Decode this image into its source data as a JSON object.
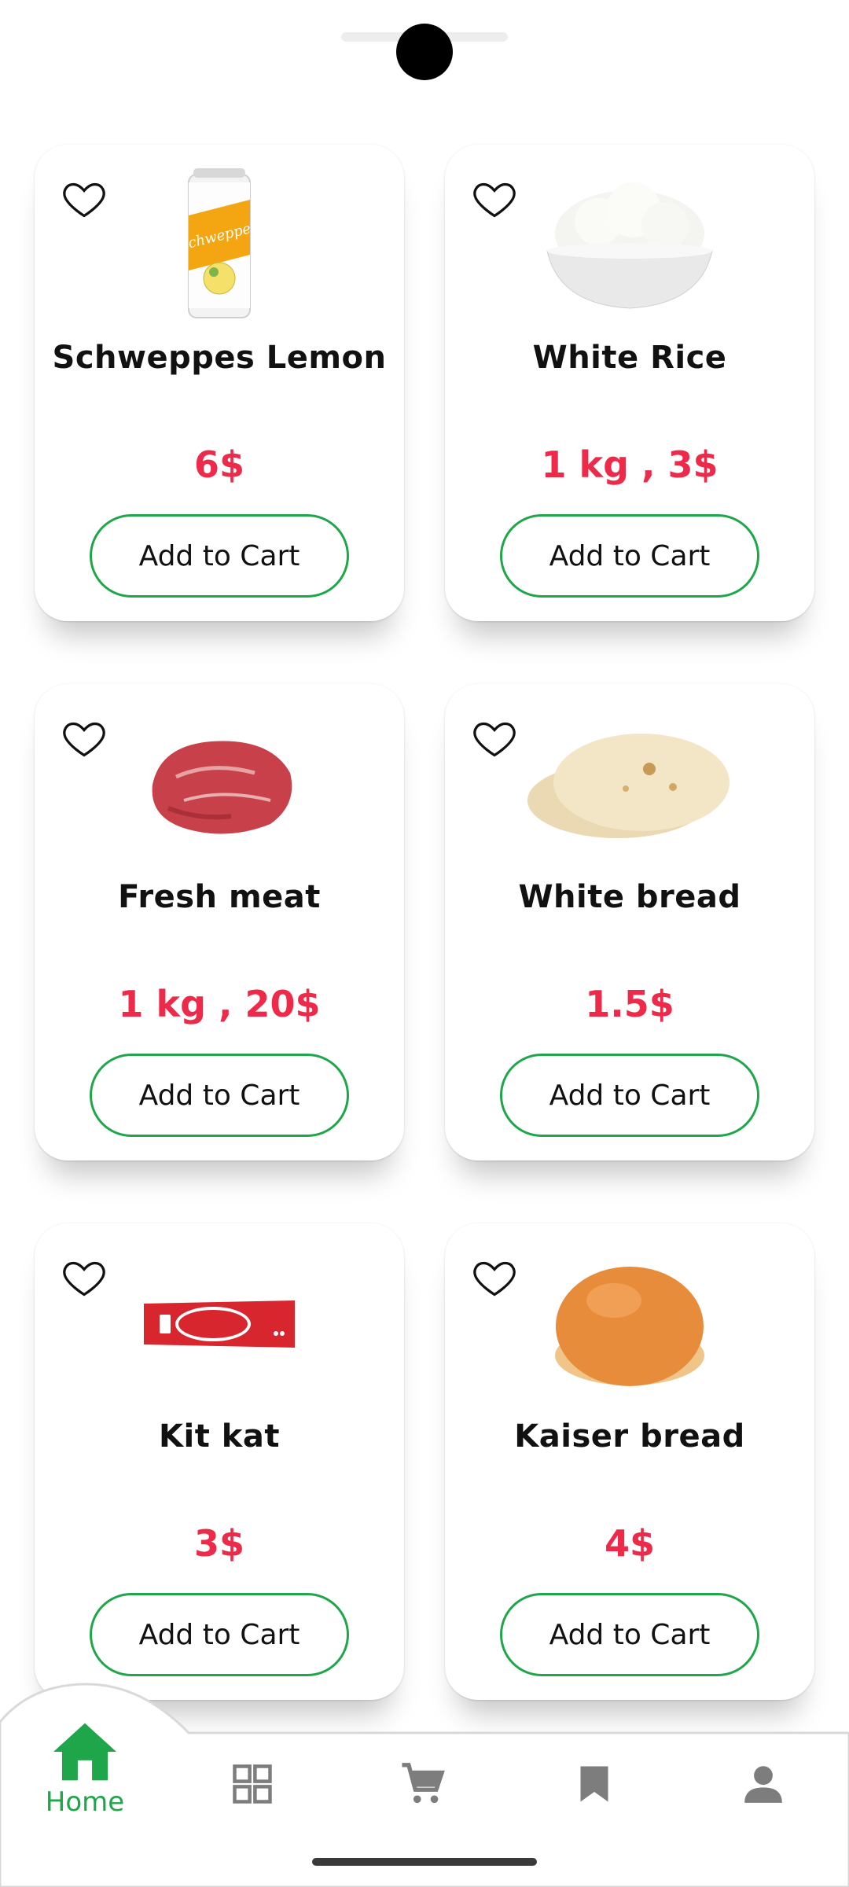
{
  "products": [
    {
      "name": "Schweppes Lemon",
      "price": "6$",
      "button": "Add to Cart",
      "image": "soda-can"
    },
    {
      "name": "White Rice",
      "price": "1 kg ,  3$",
      "button": "Add to Cart",
      "image": "rice-bowl"
    },
    {
      "name": "Fresh meat",
      "price": "1 kg ,  20$",
      "button": "Add to Cart",
      "image": "meat"
    },
    {
      "name": "White bread",
      "price": "1.5$",
      "button": "Add to Cart",
      "image": "pita-bread"
    },
    {
      "name": "Kit kat",
      "price": "3$",
      "button": "Add to Cart",
      "image": "chocolate-bar"
    },
    {
      "name": "Kaiser bread",
      "price": "4$",
      "button": "Add to Cart",
      "image": "bun"
    }
  ],
  "nav": {
    "items": [
      {
        "label": "Home",
        "icon": "home-icon",
        "active": true
      },
      {
        "icon": "grid-icon"
      },
      {
        "icon": "cart-icon"
      },
      {
        "icon": "bookmark-icon"
      },
      {
        "icon": "person-icon"
      }
    ]
  },
  "colors": {
    "accent": "#1fa64a",
    "price": "#ee2a4a",
    "nav_inactive": "#7d7d7d"
  }
}
